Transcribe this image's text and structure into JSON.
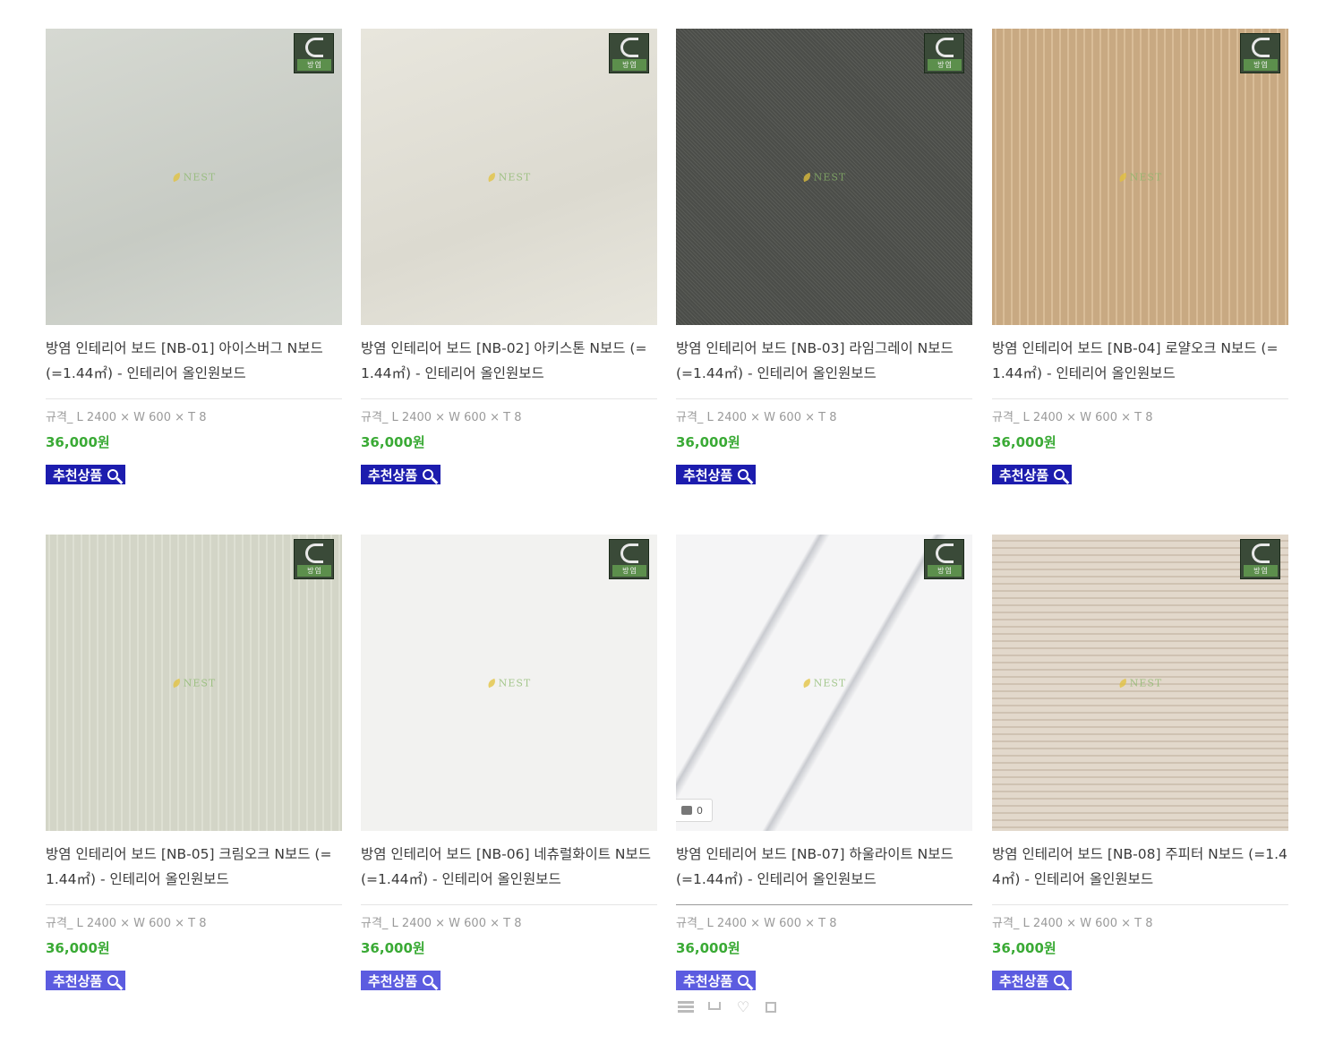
{
  "products": [
    {
      "title": "방염 인테리어 보드 [NB-01] 아이스버그 N보드 (=1.44㎡) - 인테리어 올인원보드",
      "spec": "규격_ L 2400 × W 600 × T 8",
      "price": "36,000원",
      "badge": "추천상품",
      "swatch": "#c7cbc4",
      "swatch2": "#d6d9d2",
      "pattern": "stone"
    },
    {
      "title": "방염 인테리어 보드 [NB-02] 아키스톤 N보드 (=1.44㎡) - 인테리어 올인원보드",
      "spec": "규격_ L 2400 × W 600 × T 8",
      "price": "36,000원",
      "badge": "추천상품",
      "swatch": "#dcdad0",
      "swatch2": "#e8e6dd",
      "pattern": "stone"
    },
    {
      "title": "방염 인테리어 보드 [NB-03] 라임그레이 N보드 (=1.44㎡) - 인테리어 올인원보드",
      "spec": "규격_ L 2400 × W 600 × T 8",
      "price": "36,000원",
      "badge": "추천상품",
      "swatch": "#4b4d49",
      "swatch2": "#5a5c57",
      "pattern": "grain"
    },
    {
      "title": "방염 인테리어 보드 [NB-04] 로얄오크 N보드 (=1.44㎡) - 인테리어 올인원보드",
      "spec": "규격_ L 2400 × W 600 × T 8",
      "price": "36,000원",
      "badge": "추천상품",
      "swatch": "#c8a982",
      "swatch2": "#d9bd98",
      "pattern": "wood-v"
    },
    {
      "title": "방염 인테리어 보드 [NB-05] 크림오크 N보드 (=1.44㎡) - 인테리어 올인원보드",
      "spec": "규격_ L 2400 × W 600 × T 8",
      "price": "36,000원",
      "badge": "추천상품",
      "swatch": "#d3d5c7",
      "swatch2": "#dee0d3",
      "pattern": "wood-v"
    },
    {
      "title": "방염 인테리어 보드 [NB-06] 네츄럴화이트 N보드 (=1.44㎡) - 인테리어 올인원보드",
      "spec": "규격_ L 2400 × W 600 × T 8",
      "price": "36,000원",
      "badge": "추천상품",
      "swatch": "#f2f2f0",
      "swatch2": "#f7f7f5",
      "pattern": "plain"
    },
    {
      "title": "방염 인테리어 보드 [NB-07] 하울라이트 N보드 (=1.44㎡) - 인테리어 올인원보드",
      "spec": "규격_ L 2400 × W 600 × T 8",
      "price": "36,000원",
      "badge": "추천상품",
      "swatch": "#f5f5f6",
      "swatch2": "#c9cbd0",
      "pattern": "marble",
      "like_count": "0"
    },
    {
      "title": "방염 인테리어 보드 [NB-08] 주피터 N보드 (=1.44㎡) - 인테리어 올인원보드",
      "spec": "규격_ L 2400 × W 600 × T 8",
      "price": "36,000원",
      "badge": "추천상품",
      "swatch": "#e2d8cb",
      "swatch2": "#cfc2b2",
      "pattern": "wood-h"
    }
  ],
  "watermark": "NEST",
  "kc_mark": "방염"
}
